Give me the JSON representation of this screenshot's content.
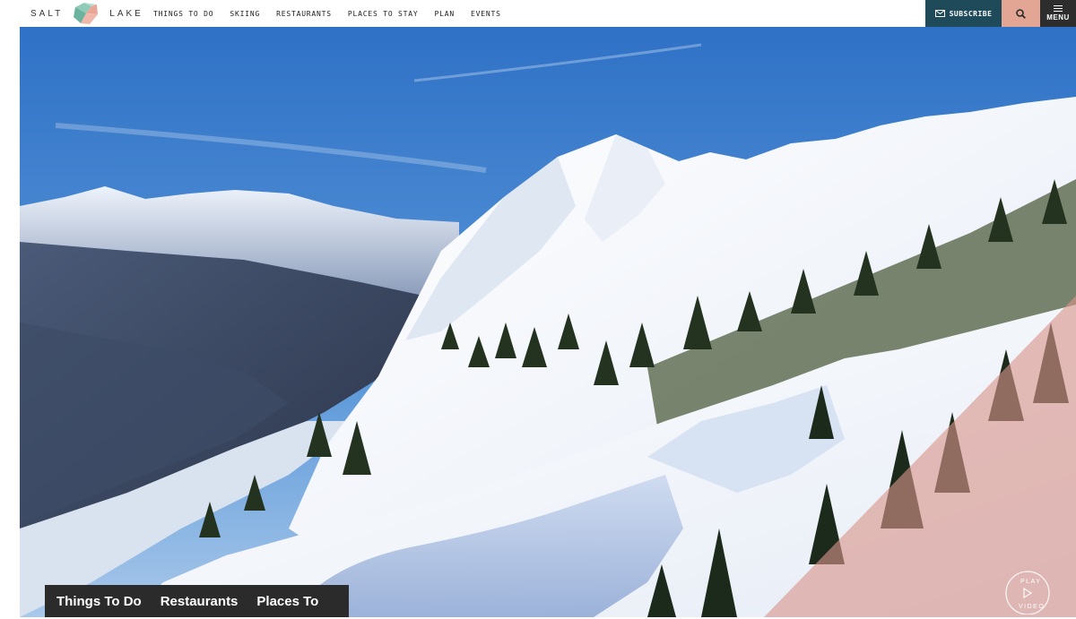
{
  "brand": {
    "word_left": "SALT",
    "word_right": "LAKE",
    "logo_icon": "geometric-gem-logo"
  },
  "nav": {
    "items": [
      {
        "label": "THINGS TO DO"
      },
      {
        "label": "SKIING"
      },
      {
        "label": "RESTAURANTS"
      },
      {
        "label": "PLACES TO STAY"
      },
      {
        "label": "PLAN"
      },
      {
        "label": "EVENTS"
      }
    ]
  },
  "actions": {
    "subscribe_label": "SUBSCRIBE",
    "subscribe_icon": "envelope-icon",
    "search_icon": "search-icon",
    "menu_label": "MENU",
    "menu_icon": "hamburger-icon"
  },
  "hero": {
    "image_description": "aerial-snowy-mountain-valley",
    "quick_tabs": [
      {
        "label": "Things To Do"
      },
      {
        "label": "Restaurants"
      },
      {
        "label": "Places To"
      }
    ],
    "play_top": "PLAY",
    "play_bottom": "VIDEO",
    "play_icon": "play-icon"
  },
  "colors": {
    "subscribe_bg": "#1e4a5a",
    "search_bg": "#e3a694",
    "menu_bg": "#2d2d2d",
    "overlay": "#d9958a",
    "tabs_bg": "#2b2b2b"
  }
}
